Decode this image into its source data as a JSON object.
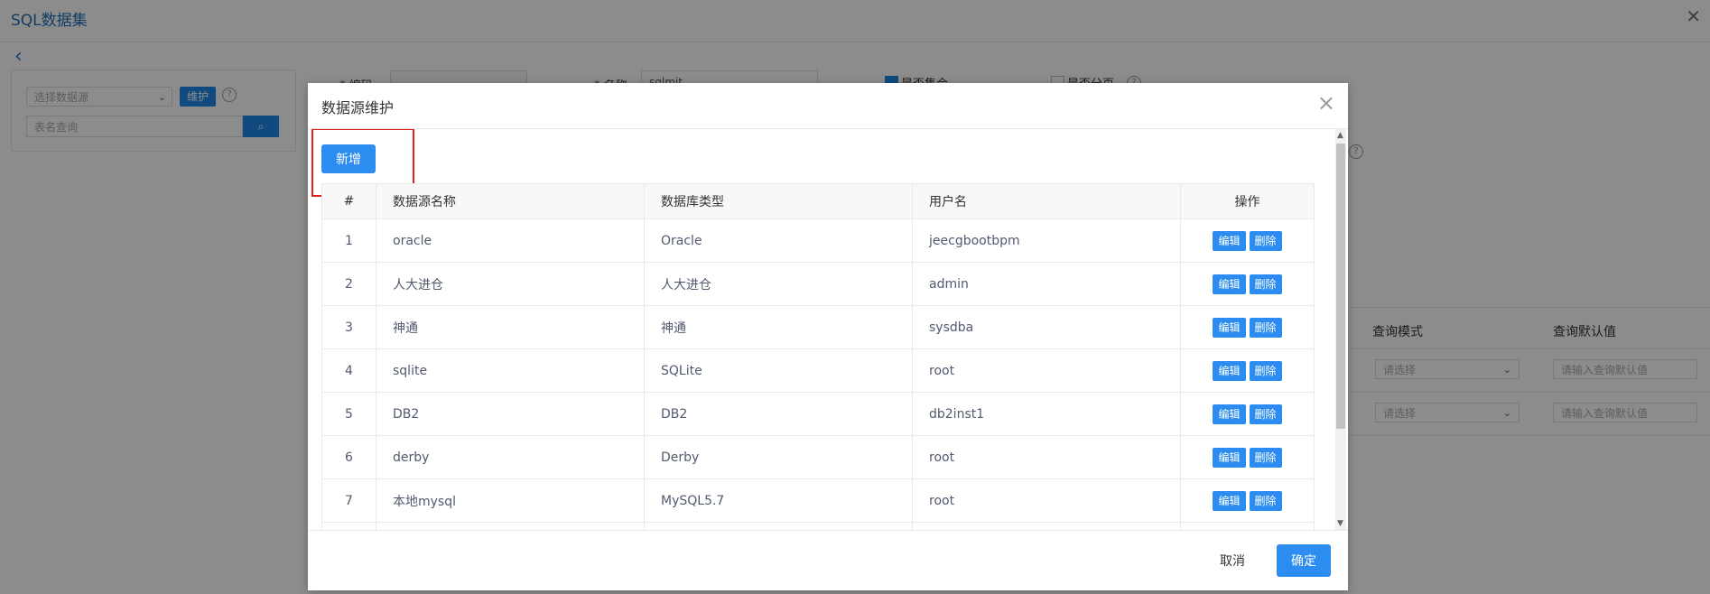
{
  "background": {
    "title": "SQL数据集",
    "select_datasource_placeholder": "选择数据源",
    "maintain_label": "维护",
    "table_search_placeholder": "表名查询",
    "field_code_label": "* 编码",
    "field_name_label": "* 名称",
    "field_name_value": "sqlmit",
    "checkbox_collection_label": "是否集合",
    "checkbox_paging_label": "是否分页",
    "query_mode_header": "查询模式",
    "query_default_header": "查询默认值",
    "select_placeholder": "请选择",
    "default_value_placeholder": "请输入查询默认值"
  },
  "modal": {
    "title": "数据源维护",
    "add_label": "新增",
    "columns": [
      "#",
      "数据源名称",
      "数据库类型",
      "用户名",
      "操作"
    ],
    "rows": [
      {
        "idx": "1",
        "name": "oracle",
        "type": "Oracle",
        "user": "jeecgbootbpm"
      },
      {
        "idx": "2",
        "name": "人大进仓",
        "type": "人大进仓",
        "user": "admin"
      },
      {
        "idx": "3",
        "name": "神通",
        "type": "神通",
        "user": "sysdba"
      },
      {
        "idx": "4",
        "name": "sqlite",
        "type": "SQLite",
        "user": "root"
      },
      {
        "idx": "5",
        "name": "DB2",
        "type": "DB2",
        "user": "db2inst1"
      },
      {
        "idx": "6",
        "name": "derby",
        "type": "Derby",
        "user": "root"
      },
      {
        "idx": "7",
        "name": "本地mysql",
        "type": "MySQL5.7",
        "user": "root"
      }
    ],
    "edit_label": "编辑",
    "delete_label": "删除",
    "cancel_label": "取消",
    "ok_label": "确定"
  },
  "colors": {
    "primary": "#2d8cf0",
    "highlight": "#e02020"
  }
}
